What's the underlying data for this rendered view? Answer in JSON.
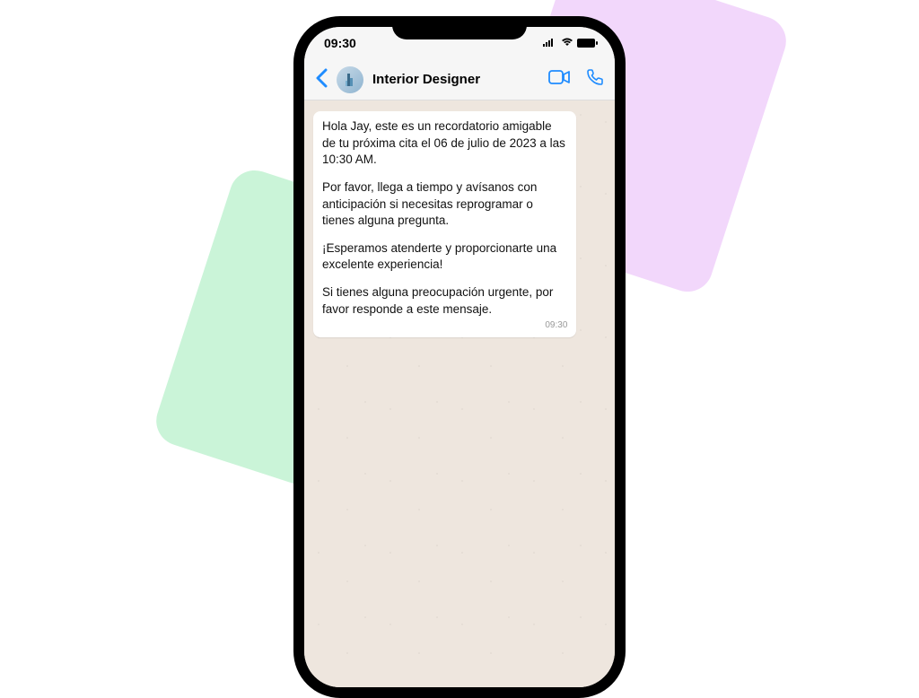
{
  "statusbar": {
    "time": "09:30"
  },
  "header": {
    "contact_name": "Interior Designer"
  },
  "message": {
    "p1": "Hola Jay, este es un recordatorio amigable de tu próxima cita el 06 de julio de 2023 a las 10:30 AM.",
    "p2": "Por favor, llega a tiempo y avísanos con anticipación si necesitas reprogramar o tienes alguna pregunta.",
    "p3": "¡Esperamos atenderte y proporcionarte una excelente experiencia!",
    "p4": "Si tienes alguna preocupación urgente, por favor responde a este mensaje.",
    "time": "09:30"
  }
}
